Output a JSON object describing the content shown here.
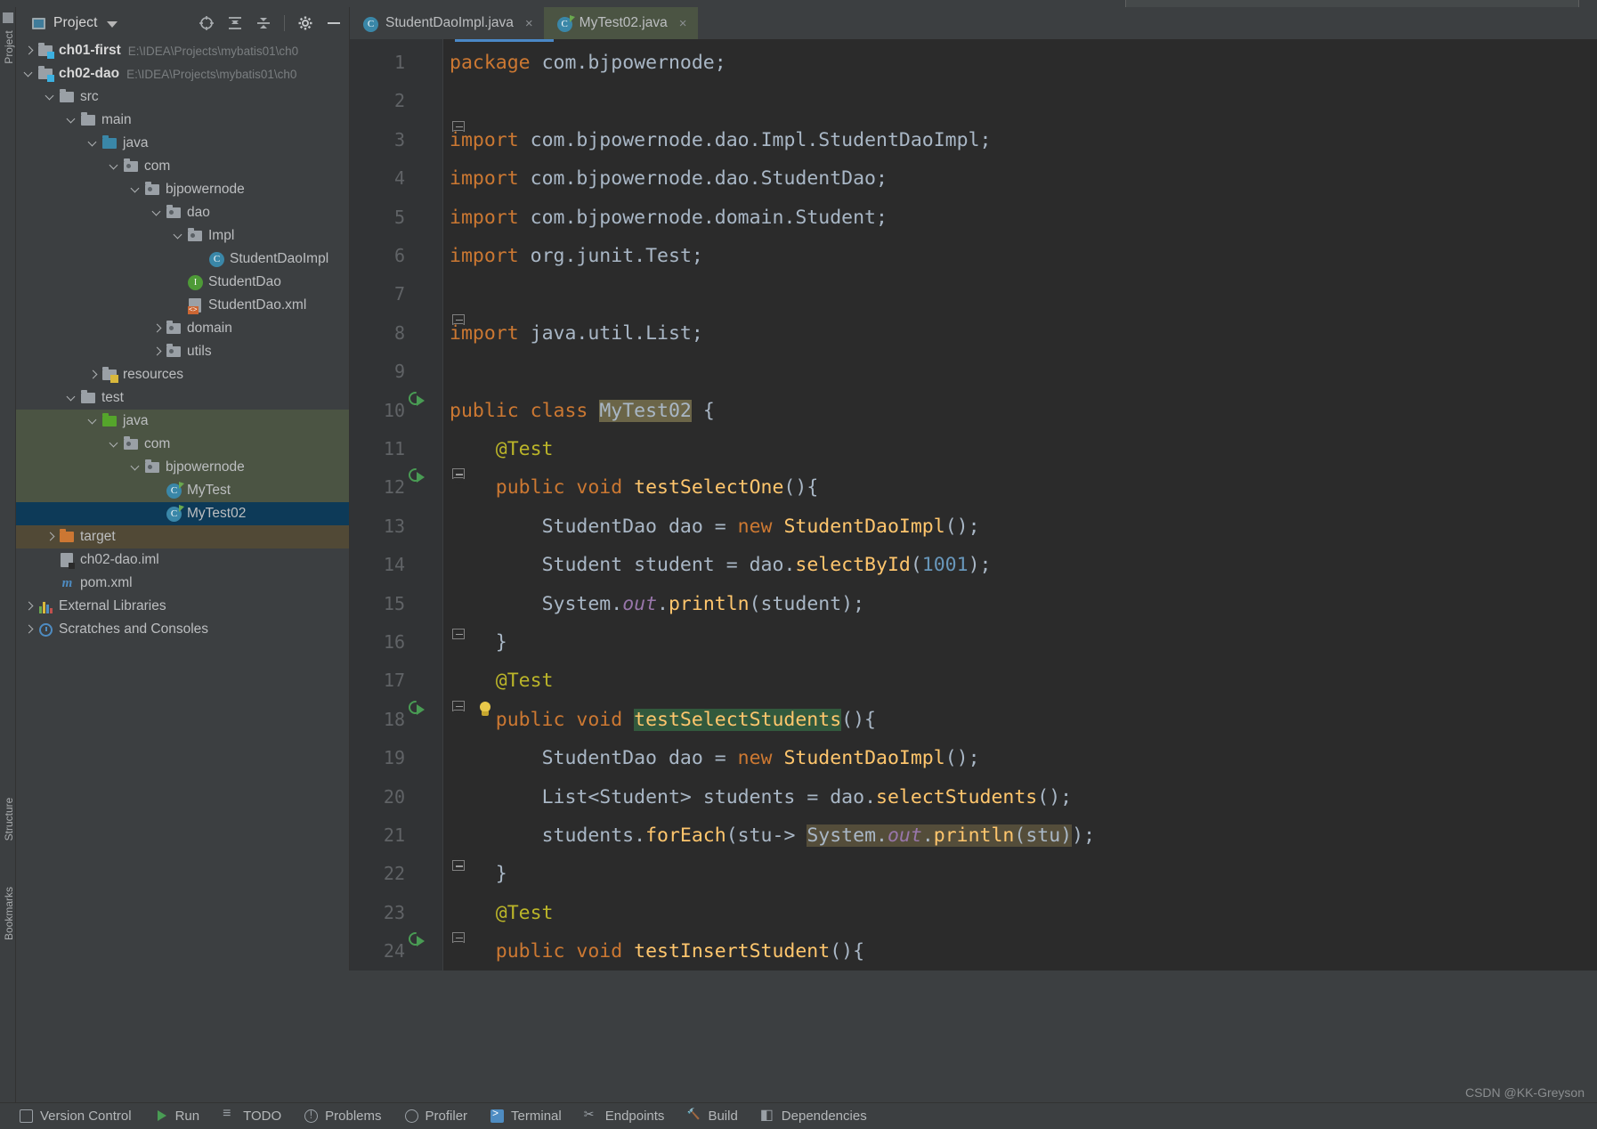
{
  "window": {
    "theme_bg": "#3c3f41",
    "editor_bg": "#2b2b2b",
    "accent": "#4a88c7",
    "watermark": "CSDN @KK-Greyson"
  },
  "project_panel": {
    "title": "Project",
    "window_icon": "project-window-icon",
    "caret": "chevron-down-icon",
    "actions": [
      {
        "name": "select-opened-file-icon",
        "label": "Select Opened File"
      },
      {
        "name": "expand-all-icon",
        "label": "Expand All"
      },
      {
        "name": "collapse-all-icon",
        "label": "Collapse All"
      },
      {
        "name": "settings-gear-icon",
        "label": "Settings"
      },
      {
        "name": "hide-panel-icon",
        "label": "Hide"
      }
    ],
    "tree": [
      {
        "label": "ch01-first",
        "path": "E:\\IDEA\\Projects\\mybatis01\\ch0",
        "indent": 0,
        "arrow": "closed",
        "icon": "module-folder-icon",
        "bold": true,
        "state": ""
      },
      {
        "label": "ch02-dao",
        "path": "E:\\IDEA\\Projects\\mybatis01\\ch0",
        "indent": 0,
        "arrow": "open",
        "icon": "module-folder-icon",
        "bold": true,
        "state": ""
      },
      {
        "label": "src",
        "path": "",
        "indent": 1,
        "arrow": "open",
        "icon": "folder-icon",
        "bold": false,
        "state": ""
      },
      {
        "label": "main",
        "path": "",
        "indent": 2,
        "arrow": "open",
        "icon": "folder-icon",
        "bold": false,
        "state": ""
      },
      {
        "label": "java",
        "path": "",
        "indent": 3,
        "arrow": "open",
        "icon": "source-root-folder-icon",
        "bold": false,
        "state": ""
      },
      {
        "label": "com",
        "path": "",
        "indent": 4,
        "arrow": "open",
        "icon": "package-icon",
        "bold": false,
        "state": ""
      },
      {
        "label": "bjpowernode",
        "path": "",
        "indent": 5,
        "arrow": "open",
        "icon": "package-icon",
        "bold": false,
        "state": ""
      },
      {
        "label": "dao",
        "path": "",
        "indent": 6,
        "arrow": "open",
        "icon": "package-icon",
        "bold": false,
        "state": ""
      },
      {
        "label": "Impl",
        "path": "",
        "indent": 7,
        "arrow": "open",
        "icon": "package-icon",
        "bold": false,
        "state": ""
      },
      {
        "label": "StudentDaoImpl",
        "path": "",
        "indent": 8,
        "arrow": "none",
        "icon": "java-class-icon",
        "bold": false,
        "state": ""
      },
      {
        "label": "StudentDao",
        "path": "",
        "indent": 7,
        "arrow": "none",
        "icon": "java-interface-icon",
        "bold": false,
        "state": ""
      },
      {
        "label": "StudentDao.xml",
        "path": "",
        "indent": 7,
        "arrow": "none",
        "icon": "xml-file-icon",
        "bold": false,
        "state": ""
      },
      {
        "label": "domain",
        "path": "",
        "indent": 6,
        "arrow": "closed",
        "icon": "package-icon",
        "bold": false,
        "state": ""
      },
      {
        "label": "utils",
        "path": "",
        "indent": 6,
        "arrow": "closed",
        "icon": "package-icon",
        "bold": false,
        "state": ""
      },
      {
        "label": "resources",
        "path": "",
        "indent": 3,
        "arrow": "closed",
        "icon": "resources-folder-icon",
        "bold": false,
        "state": ""
      },
      {
        "label": "test",
        "path": "",
        "indent": 2,
        "arrow": "open",
        "icon": "folder-icon",
        "bold": false,
        "state": ""
      },
      {
        "label": "java",
        "path": "",
        "indent": 3,
        "arrow": "open",
        "icon": "test-source-root-folder-icon",
        "bold": false,
        "state": "green"
      },
      {
        "label": "com",
        "path": "",
        "indent": 4,
        "arrow": "open",
        "icon": "package-icon",
        "bold": false,
        "state": "green"
      },
      {
        "label": "bjpowernode",
        "path": "",
        "indent": 5,
        "arrow": "open",
        "icon": "package-icon",
        "bold": false,
        "state": "green"
      },
      {
        "label": "MyTest",
        "path": "",
        "indent": 6,
        "arrow": "none",
        "icon": "java-test-class-icon",
        "bold": false,
        "state": "green"
      },
      {
        "label": "MyTest02",
        "path": "",
        "indent": 6,
        "arrow": "none",
        "icon": "java-test-class-icon",
        "bold": false,
        "state": "selected"
      },
      {
        "label": "target",
        "path": "",
        "indent": 1,
        "arrow": "closed",
        "icon": "excluded-folder-icon",
        "bold": false,
        "state": "brown"
      },
      {
        "label": "ch02-dao.iml",
        "path": "",
        "indent": 1,
        "arrow": "none",
        "icon": "iml-file-icon",
        "bold": false,
        "state": ""
      },
      {
        "label": "pom.xml",
        "path": "",
        "indent": 1,
        "arrow": "none",
        "icon": "maven-file-icon",
        "bold": false,
        "state": ""
      },
      {
        "label": "External Libraries",
        "path": "",
        "indent": 0,
        "arrow": "closed",
        "icon": "libraries-icon",
        "bold": false,
        "state": ""
      },
      {
        "label": "Scratches and Consoles",
        "path": "",
        "indent": 0,
        "arrow": "closed",
        "icon": "scratches-icon",
        "bold": false,
        "state": ""
      }
    ]
  },
  "left_rail": {
    "labels": [
      "Project",
      "Structure",
      "Bookmarks"
    ]
  },
  "editor": {
    "tabs": [
      {
        "label": "StudentDaoImpl.java",
        "icon": "java-class-icon",
        "active": false,
        "close": "×"
      },
      {
        "label": "MyTest02.java",
        "icon": "java-test-class-icon",
        "active": true,
        "close": "×"
      }
    ],
    "lines": [
      {
        "n": "1",
        "gutter": "",
        "fold": "",
        "text": "package com.bjpowernode;"
      },
      {
        "n": "2",
        "gutter": "",
        "fold": "",
        "text": ""
      },
      {
        "n": "3",
        "gutter": "",
        "fold": "import-start",
        "text": "import com.bjpowernode.dao.Impl.StudentDaoImpl;"
      },
      {
        "n": "4",
        "gutter": "",
        "fold": "",
        "text": "import com.bjpowernode.dao.StudentDao;"
      },
      {
        "n": "5",
        "gutter": "",
        "fold": "",
        "text": "import com.bjpowernode.domain.Student;"
      },
      {
        "n": "6",
        "gutter": "",
        "fold": "",
        "text": "import org.junit.Test;"
      },
      {
        "n": "7",
        "gutter": "",
        "fold": "",
        "text": ""
      },
      {
        "n": "8",
        "gutter": "",
        "fold": "import-start",
        "text": "import java.util.List;"
      },
      {
        "n": "9",
        "gutter": "",
        "fold": "",
        "text": ""
      },
      {
        "n": "10",
        "gutter": "run",
        "fold": "",
        "text": "public class MyTest02 {"
      },
      {
        "n": "11",
        "gutter": "",
        "fold": "",
        "text": "    @Test"
      },
      {
        "n": "12",
        "gutter": "run",
        "fold": "method-start",
        "text": "    public void testSelectOne(){"
      },
      {
        "n": "13",
        "gutter": "",
        "fold": "",
        "text": "        StudentDao dao = new StudentDaoImpl();"
      },
      {
        "n": "14",
        "gutter": "",
        "fold": "",
        "text": "        Student student = dao.selectById(1001);"
      },
      {
        "n": "15",
        "gutter": "",
        "fold": "",
        "text": "        System.out.println(student);"
      },
      {
        "n": "16",
        "gutter": "",
        "fold": "method-end",
        "text": "    }"
      },
      {
        "n": "17",
        "gutter": "",
        "fold": "",
        "text": "    @Test"
      },
      {
        "n": "18",
        "gutter": "run",
        "fold": "method-start",
        "bulb": true,
        "text": "    public void testSelectStudents(){"
      },
      {
        "n": "19",
        "gutter": "",
        "fold": "",
        "text": "        StudentDao dao = new StudentDaoImpl();"
      },
      {
        "n": "20",
        "gutter": "",
        "fold": "",
        "text": "        List<Student> students = dao.selectStudents();"
      },
      {
        "n": "21",
        "gutter": "",
        "fold": "",
        "text": "        students.forEach(stu-> System.out.println(stu));"
      },
      {
        "n": "22",
        "gutter": "",
        "fold": "method-end",
        "text": "    }"
      },
      {
        "n": "23",
        "gutter": "",
        "fold": "",
        "text": "    @Test"
      },
      {
        "n": "24",
        "gutter": "run",
        "fold": "method-start",
        "text": "    public void testInsertStudent(){"
      }
    ],
    "highlights": {
      "class_name": "MyTest02",
      "search_match": "testSelectStudents",
      "occurrence": "System.out.println(stu)"
    },
    "colors": {
      "keyword": "#cc7832",
      "method": "#ffc66d",
      "annotation": "#bbb529",
      "number": "#6897bb",
      "static_field": "#9876aa",
      "text": "#a9b7c6",
      "line_number": "#606366",
      "identifier_highlight": "#6b6548",
      "search_highlight": "#32593d"
    }
  },
  "bottom_bar": {
    "items": [
      {
        "label": "Version Control",
        "icon": "version-control-icon"
      },
      {
        "label": "Run",
        "icon": "run-icon"
      },
      {
        "label": "TODO",
        "icon": "todo-icon"
      },
      {
        "label": "Problems",
        "icon": "problems-icon"
      },
      {
        "label": "Profiler",
        "icon": "profiler-icon"
      },
      {
        "label": "Terminal",
        "icon": "terminal-icon"
      },
      {
        "label": "Endpoints",
        "icon": "endpoints-icon"
      },
      {
        "label": "Build",
        "icon": "build-icon"
      },
      {
        "label": "Dependencies",
        "icon": "dependencies-icon"
      }
    ]
  }
}
